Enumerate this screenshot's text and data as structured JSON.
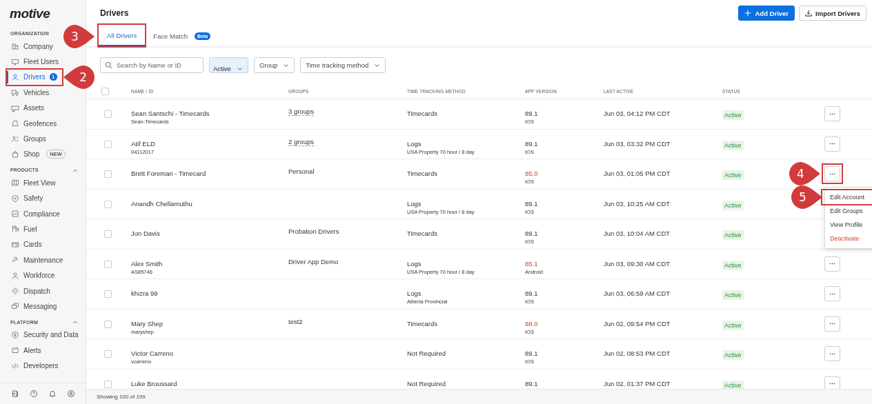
{
  "sidebar": {
    "logo": "motive",
    "sections": [
      {
        "label": "ORGANIZATION",
        "kind": "static",
        "items": [
          {
            "label": "Company",
            "selected": false,
            "highlighted": false
          },
          {
            "label": "Fleet Users",
            "selected": false,
            "highlighted": false
          },
          {
            "label": "Drivers",
            "selected": true,
            "highlighted": true,
            "badge": {
              "text": "1",
              "kind": "count"
            },
            "callout": {
              "number": "2"
            }
          },
          {
            "label": "Vehicles",
            "selected": false,
            "highlighted": false
          },
          {
            "label": "Assets",
            "selected": false,
            "highlighted": false
          },
          {
            "label": "Geofences",
            "selected": false,
            "highlighted": false
          },
          {
            "label": "Groups",
            "selected": false,
            "highlighted": false
          },
          {
            "label": "Shop",
            "selected": false,
            "highlighted": false,
            "badge": {
              "text": "NEW",
              "kind": "tag"
            }
          }
        ]
      },
      {
        "label": "PRODUCTS",
        "kind": "collapsible",
        "expanded": true,
        "items": [
          {
            "label": "Fleet View",
            "selected": false,
            "highlighted": false
          },
          {
            "label": "Safety",
            "selected": false,
            "highlighted": false
          },
          {
            "label": "Compliance",
            "selected": false,
            "highlighted": false
          },
          {
            "label": "Fuel",
            "selected": false,
            "highlighted": false
          },
          {
            "label": "Cards",
            "selected": false,
            "highlighted": false
          },
          {
            "label": "Maintenance",
            "selected": false,
            "highlighted": false
          },
          {
            "label": "Workforce",
            "selected": false,
            "highlighted": false
          },
          {
            "label": "Dispatch",
            "selected": false,
            "highlighted": false
          },
          {
            "label": "Messaging",
            "selected": false,
            "highlighted": false
          }
        ]
      },
      {
        "label": "PLATFORM",
        "kind": "collapsible",
        "expanded": true,
        "items": [
          {
            "label": "Security and Data",
            "selected": false,
            "highlighted": false
          },
          {
            "label": "Alerts",
            "selected": false,
            "highlighted": false
          },
          {
            "label": "Developers",
            "selected": false,
            "highlighted": false
          }
        ]
      }
    ]
  },
  "page": {
    "title": "Drivers",
    "buttons": [
      {
        "label": "Add Driver",
        "kind": "primary"
      },
      {
        "label": "Import Drivers",
        "kind": "secondary"
      }
    ]
  },
  "tabs": [
    {
      "label": "All Drivers",
      "selected": true,
      "highlighted": true,
      "callout": {
        "number": "3"
      }
    },
    {
      "label": "Face Match",
      "selected": false,
      "highlighted": false,
      "badge": "Beta"
    }
  ],
  "filters": {
    "search": {
      "placeholder": "Search by Name or ID"
    },
    "dropdowns": [
      {
        "label": "Active",
        "active": true
      },
      {
        "label": "Group",
        "active": false
      },
      {
        "label": "Time tracking method",
        "active": false
      }
    ]
  },
  "table": {
    "select_all": false,
    "columns": [
      "NAME / ID",
      "GROUPS",
      "TIME TRACKING METHOD",
      "APP VERSION",
      "LAST ACTIVE",
      "STATUS"
    ],
    "rows": [
      {
        "selected": false,
        "name": "Sean Santschi  -  Timecards",
        "id": "Sean-Timecards",
        "groups": "3 groups",
        "groups_expandable": true,
        "method": "Timecards",
        "version": "89.1",
        "version_outdated": false,
        "platform": "IOS",
        "last_active": "Jun 03, 04:12 PM CDT",
        "status": "Active",
        "menu_open": false
      },
      {
        "selected": false,
        "name": "Atif ELD",
        "id": "04112017",
        "groups": "2 groups",
        "groups_expandable": true,
        "method": "Logs",
        "method_detail": "USA Property 70 hour / 8 day",
        "version": "89.1",
        "version_outdated": false,
        "platform": "IOS",
        "last_active": "Jun 03, 03:32 PM CDT",
        "status": "Active",
        "menu_open": false
      },
      {
        "selected": false,
        "name": "Brett Foreman - Timecard",
        "groups": "Personal",
        "groups_expandable": false,
        "method": "Timecards",
        "version": "85.0",
        "version_outdated": true,
        "platform": "IOS",
        "last_active": "Jun 03, 01:05 PM CDT",
        "status": "Active",
        "menu_open": true,
        "callout": {
          "number": "4"
        }
      },
      {
        "selected": false,
        "name": "Anandh Chellamuthu",
        "method": "Logs",
        "method_detail": "USA Property 70 hour / 8 day",
        "version": "89.1",
        "version_outdated": false,
        "platform": "IOS",
        "last_active": "Jun 03, 10:25 AM CDT",
        "status": "Active",
        "menu_open": false
      },
      {
        "selected": false,
        "name": "Jon Davis",
        "groups": "Probation Drivers",
        "groups_expandable": false,
        "method": "Timecards",
        "version": "89.1",
        "version_outdated": false,
        "platform": "IOS",
        "last_active": "Jun 03, 10:04 AM CDT",
        "status": "Active",
        "menu_open": false
      },
      {
        "selected": false,
        "name": "Alex Smith",
        "id": "AS85746",
        "groups": "Driver App Demo",
        "groups_expandable": false,
        "method": "Logs",
        "method_detail": "USA Property 70 hour / 8 day",
        "version": "85.1",
        "version_outdated": true,
        "platform": "Android",
        "last_active": "Jun 03, 09:30 AM CDT",
        "status": "Active",
        "menu_open": false
      },
      {
        "selected": false,
        "name": "khizra 99",
        "method": "Logs",
        "method_detail": "Alberta Provincial",
        "version": "89.1",
        "version_outdated": false,
        "platform": "IOS",
        "last_active": "Jun 03, 06:59 AM CDT",
        "status": "Active",
        "menu_open": false
      },
      {
        "selected": false,
        "name": "Mary Shep",
        "id": "maryshep",
        "groups": "test2",
        "groups_expandable": false,
        "method": "Timecards",
        "version": "88.0",
        "version_outdated": true,
        "platform": "IOS",
        "last_active": "Jun 02, 09:54 PM CDT",
        "status": "Active",
        "menu_open": false
      },
      {
        "selected": false,
        "name": "Victor Carreno",
        "id": "vcarreno",
        "method": "Not Required",
        "version": "89.1",
        "version_outdated": false,
        "platform": "IOS",
        "last_active": "Jun 02, 08:53 PM CDT",
        "status": "Active",
        "menu_open": false
      },
      {
        "selected": false,
        "name": "Luke Broussard",
        "method": "Not Required",
        "version": "89.1",
        "version_outdated": false,
        "last_active": "Jun 02, 01:37 PM CDT",
        "status": "Active",
        "menu_open": false
      }
    ],
    "row_menu": [
      {
        "label": "Edit Account",
        "kind": "normal",
        "highlighted": true,
        "callout": {
          "number": "5"
        }
      },
      {
        "label": "Edit Groups",
        "kind": "normal",
        "highlighted": false
      },
      {
        "label": "View Profile",
        "kind": "normal",
        "highlighted": false
      },
      {
        "label": "Deactivate",
        "kind": "danger",
        "highlighted": false
      }
    ]
  },
  "footer": {
    "text": "Showing 100 of 199"
  }
}
